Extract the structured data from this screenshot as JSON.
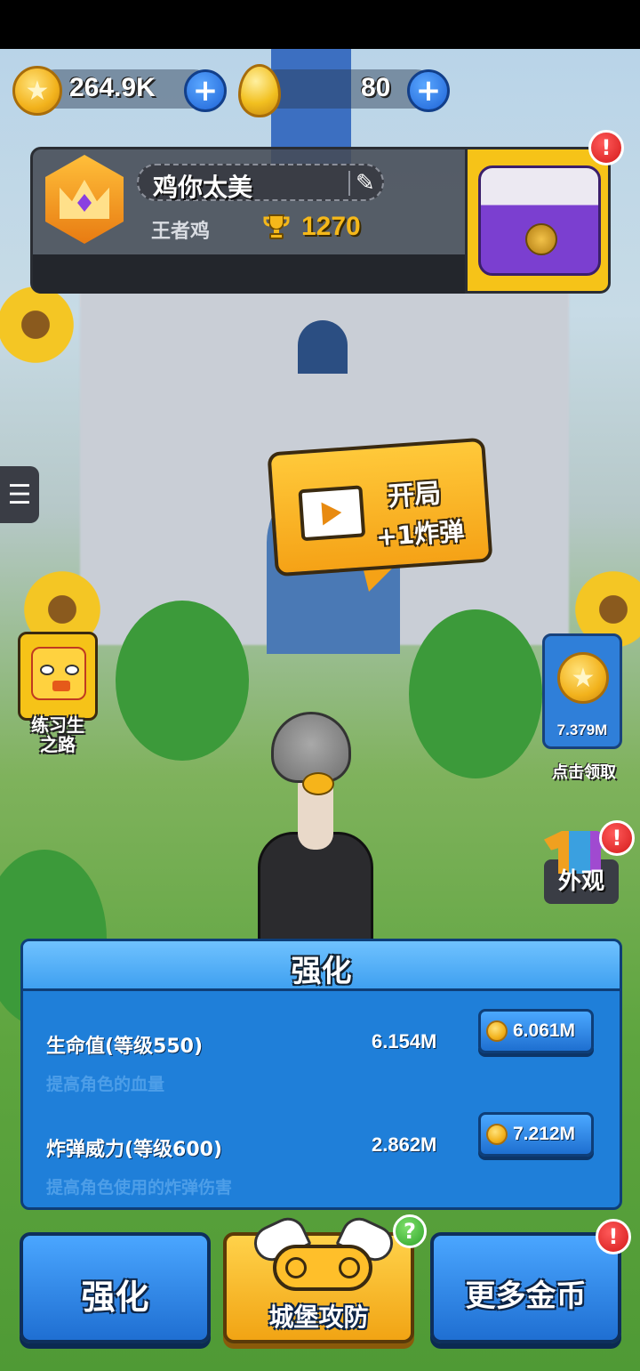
{
  "currencies": {
    "gold": {
      "value": "264.9K",
      "icon": "star-coin-icon"
    },
    "eggs": {
      "value": "80",
      "icon": "golden-egg-icon"
    },
    "add_symbol": "+"
  },
  "profile": {
    "name": "鸡你太美",
    "title": "王者鸡",
    "trophies": "1270",
    "edit_symbol": "✎",
    "trophy_symbol": "🏆",
    "menu_symbol": "☰",
    "alert_symbol": "!"
  },
  "start_offer": {
    "title": "开局",
    "subtitle": "+1炸弹"
  },
  "left_event": {
    "label_line1": "练习生",
    "label_line2": "之路"
  },
  "collect": {
    "value": "7.379M",
    "label": "点击领取",
    "coin_symbol": "★"
  },
  "outfit": {
    "label": "外观"
  },
  "upgrade_panel": {
    "title": "强化",
    "rows": [
      {
        "name": "生命值(等级550)",
        "description": "提高角色的血量",
        "value": "6.154M",
        "cost": "6.061M"
      },
      {
        "name": "炸弹威力(等级600)",
        "description": "提高角色使用的炸弹伤害",
        "value": "2.862M",
        "cost": "7.212M"
      }
    ]
  },
  "nav": {
    "upgrade": "强化",
    "castle_defense": "城堡攻防",
    "more_coins": "更多金币",
    "help_symbol": "?"
  },
  "colors": {
    "accent_blue": "#1f7fd9",
    "accent_gold": "#f6c318",
    "alert_red": "#d41a1a"
  }
}
